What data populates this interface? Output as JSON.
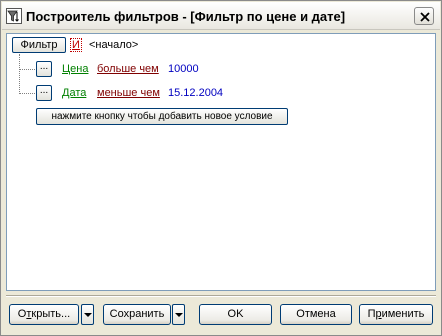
{
  "window": {
    "title": "Построитель фильтров - [Фильтр по цене и дате]",
    "icon": "filter-funnel-icon",
    "close_icon": "close-icon"
  },
  "root": {
    "filter_button": "Фильтр",
    "operator": "И",
    "label": "<начало>"
  },
  "conditions": [
    {
      "menu_button": "...",
      "field": "Цена",
      "operator": "больше чем",
      "value": "10000"
    },
    {
      "menu_button": "...",
      "field": "Дата",
      "operator": "меньше чем",
      "value": "15.12.2004"
    }
  ],
  "add_condition_button": "нажмите кнопку чтобы добавить новое условие",
  "footer": {
    "open_prefix": "О",
    "open_mnemonic": "т",
    "open_suffix": "крыть...",
    "save_label": "Сохранить",
    "ok_label": "OK",
    "cancel_label": "Отмена",
    "apply_prefix": "П",
    "apply_mnemonic": "р",
    "apply_suffix": "именить"
  },
  "colors": {
    "field": "#008000",
    "operator": "#800000",
    "value": "#0000c0",
    "logic_operator": "#c00000"
  }
}
